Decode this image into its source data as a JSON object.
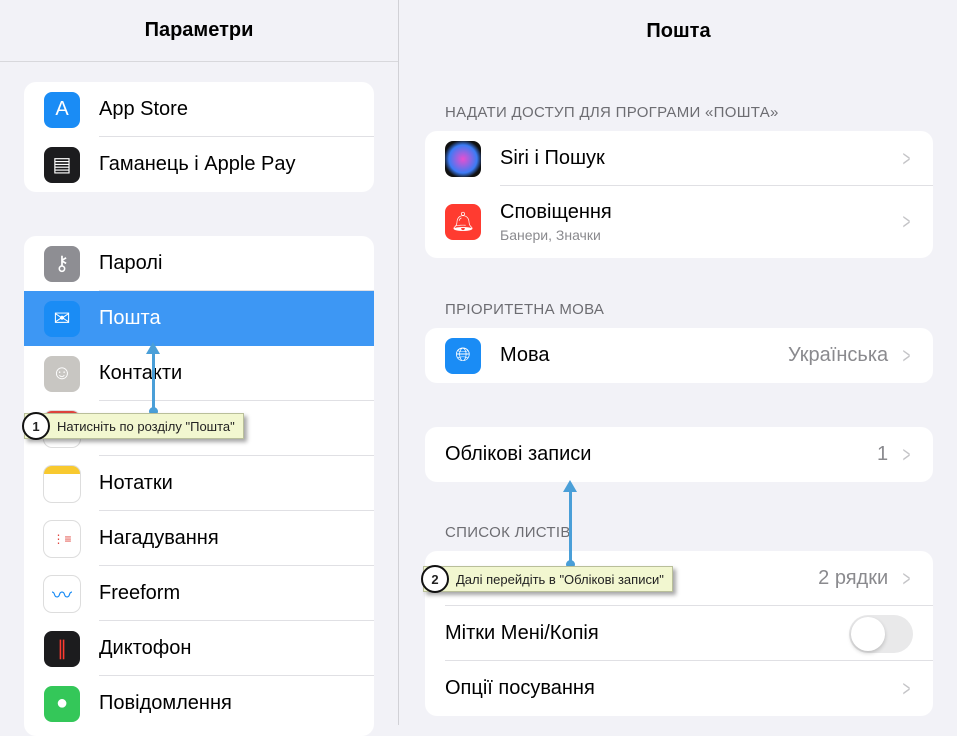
{
  "left": {
    "title": "Параметри",
    "group1": [
      {
        "label": "App Store",
        "icon": "app-store-icon",
        "color": "#1a8cf5"
      },
      {
        "label": "Гаманець і Apple Pay",
        "icon": "wallet-icon",
        "color": "#1c1c1e"
      }
    ],
    "group2": [
      {
        "label": "Паролі",
        "icon": "key-icon",
        "color": "#8e8e93"
      },
      {
        "label": "Пошта",
        "icon": "mail-icon",
        "color": "#1a8cf5",
        "selected": true
      },
      {
        "label": "Контакти",
        "icon": "contacts-icon",
        "color": "#c8c6c2"
      },
      {
        "label": "",
        "icon": "calendar-icon",
        "color": "#ffffff"
      },
      {
        "label": "Нотатки",
        "icon": "notes-icon",
        "color": "#ffffff"
      },
      {
        "label": "Нагадування",
        "icon": "reminders-icon",
        "color": "#ffffff"
      },
      {
        "label": "Freeform",
        "icon": "freeform-icon",
        "color": "#ffffff"
      },
      {
        "label": "Диктофон",
        "icon": "voice-memos-icon",
        "color": "#1c1c1e"
      },
      {
        "label": "Повідомлення",
        "icon": "messages-icon",
        "color": "#34c759"
      }
    ]
  },
  "right": {
    "title": "Пошта",
    "sec1": "НАДАТИ ДОСТУП ДЛЯ ПРОГРАМИ «ПОШТА»",
    "siri": "Siri і Пошук",
    "notif": "Сповіщення",
    "notif_sub": "Банери, Значки",
    "sec2": "ПРІОРИТЕТНА МОВА",
    "lang": "Мова",
    "lang_val": "Українська",
    "accounts": "Облікові записи",
    "accounts_val": "1",
    "sec3": "СПИСОК ЛИСТІВ",
    "preview_val": "2 рядки",
    "tocc": "Мітки Мені/Копія",
    "tocc_on": false,
    "swipe": "Опції посування"
  },
  "tips": [
    {
      "n": "1",
      "text": "Натисніть по розділу \"Пошта\""
    },
    {
      "n": "2",
      "text": "Далі перейдіть в \"Облікові записи\""
    }
  ]
}
